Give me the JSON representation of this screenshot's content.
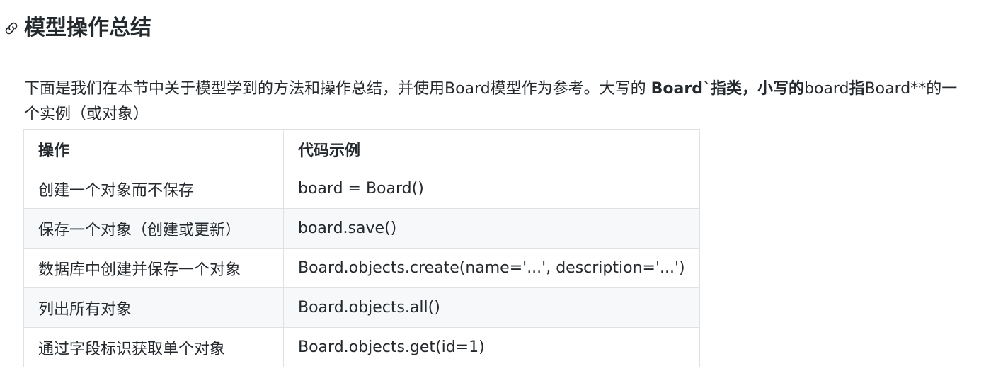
{
  "heading": {
    "icon": "link-icon",
    "title": "模型操作总结"
  },
  "intro": {
    "part1": "下面是我们在本节中关于模型学到的方法和操作总结，并使用Board模型作为参考。大写的 ",
    "bold1": "Board`指类，小写的",
    "part2": "board",
    "bold2": "指",
    "part3": "Board**的一个实例（或对象）"
  },
  "table": {
    "headers": [
      "操作",
      "代码示例"
    ],
    "rows": [
      [
        "创建一个对象而不保存",
        "board = Board()"
      ],
      [
        "保存一个对象（创建或更新）",
        "board.save()"
      ],
      [
        "数据库中创建并保存一个对象",
        "Board.objects.create(name='...', description='...')"
      ],
      [
        "列出所有对象",
        "Board.objects.all()"
      ],
      [
        "通过字段标识获取单个对象",
        "Board.objects.get(id=1)"
      ]
    ]
  }
}
